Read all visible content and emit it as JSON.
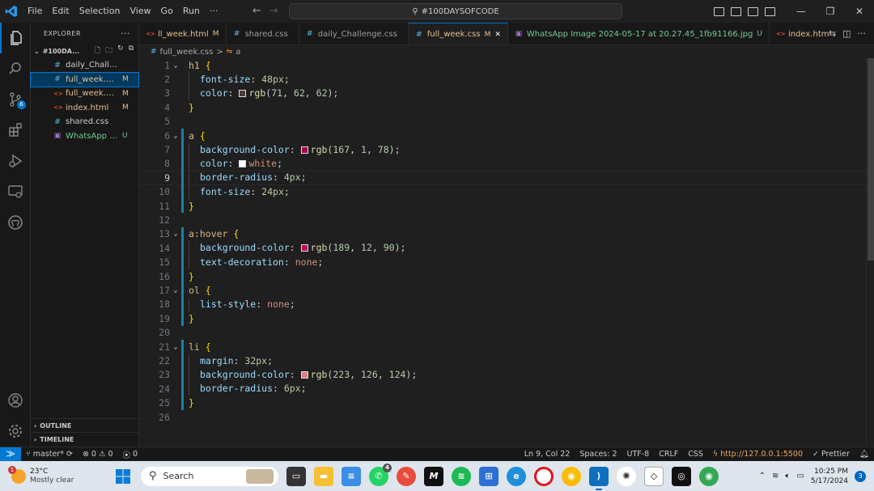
{
  "titlebar": {
    "menus": [
      "File",
      "Edit",
      "Selection",
      "View",
      "Go",
      "Run",
      "···"
    ],
    "search_text": "#100DAYSOFCODE",
    "window_controls": [
      "—",
      "❐",
      "✕"
    ]
  },
  "activity_bar": {
    "icons": [
      "files-icon",
      "search-icon",
      "source-control-icon",
      "extensions-icon",
      "run-debug-icon",
      "remote-explorer-icon",
      "github-icon"
    ],
    "source_control_badge": "6",
    "bottom_icons": [
      "account-icon",
      "settings-icon"
    ]
  },
  "sidebar": {
    "title": "EXPLORER",
    "menu_glyph": "···",
    "folder": "#100DA...",
    "files": [
      {
        "name": "daily_Challenge.css",
        "status": "",
        "type": "css",
        "color": "#cccccc"
      },
      {
        "name": "full_week.css",
        "status": "M",
        "type": "css",
        "color": "#e2c08d"
      },
      {
        "name": "full_week.ht...",
        "status": "M",
        "type": "html",
        "color": "#e2c08d"
      },
      {
        "name": "index.html",
        "status": "M",
        "type": "html",
        "color": "#e2c08d"
      },
      {
        "name": "shared.css",
        "status": "",
        "type": "css",
        "color": "#cccccc"
      },
      {
        "name": "WhatsApp I...",
        "status": "U",
        "type": "img",
        "color": "#73c991"
      }
    ],
    "outline_label": "OUTLINE",
    "timeline_label": "TIMELINE"
  },
  "tabs": [
    {
      "name": "ll_week.html",
      "status": "M",
      "type": "html",
      "active": false
    },
    {
      "name": "shared.css",
      "status": "",
      "type": "css",
      "active": false
    },
    {
      "name": "daily_Challenge.css",
      "status": "",
      "type": "css",
      "active": false
    },
    {
      "name": "full_week.css",
      "status": "M",
      "type": "css",
      "active": true
    },
    {
      "name": "WhatsApp Image 2024-05-17 at 20.27.45_1fb91166.jpg",
      "status": "U",
      "type": "img",
      "active": false
    },
    {
      "name": "index.html",
      "status": "M",
      "type": "html",
      "active": false
    }
  ],
  "breadcrumb": {
    "file": "full_week.css",
    "separator": ">",
    "symbol": "a"
  },
  "editor": {
    "current_line": 9,
    "lines": [
      {
        "n": 1,
        "fold": true,
        "indent": 0,
        "parts": [
          [
            "sel",
            "h1"
          ],
          [
            "txt",
            " "
          ],
          [
            "brace",
            "{"
          ]
        ]
      },
      {
        "n": 2,
        "indent": 1,
        "parts": [
          [
            "prop",
            "font-size"
          ],
          [
            "txt",
            ": "
          ],
          [
            "num",
            "48px"
          ],
          [
            "txt",
            ";"
          ]
        ]
      },
      {
        "n": 3,
        "indent": 1,
        "parts": [
          [
            "prop",
            "color"
          ],
          [
            "txt",
            ": "
          ],
          [
            "swatch",
            "#473e3e"
          ],
          [
            "fn",
            "rgb"
          ],
          [
            "txt",
            "("
          ],
          [
            "num",
            "71"
          ],
          [
            "txt",
            ", "
          ],
          [
            "num",
            "62"
          ],
          [
            "txt",
            ", "
          ],
          [
            "num",
            "62"
          ],
          [
            "txt",
            ");"
          ]
        ]
      },
      {
        "n": 4,
        "indent": 0,
        "parts": [
          [
            "brace",
            "}"
          ]
        ]
      },
      {
        "n": 5,
        "indent": 0,
        "parts": []
      },
      {
        "n": 6,
        "fold": true,
        "indent": 0,
        "mod": true,
        "parts": [
          [
            "sel",
            "a"
          ],
          [
            "txt",
            " "
          ],
          [
            "brace",
            "{"
          ]
        ]
      },
      {
        "n": 7,
        "indent": 1,
        "mod": true,
        "parts": [
          [
            "prop",
            "background-color"
          ],
          [
            "txt",
            ": "
          ],
          [
            "swatch",
            "#a7014e"
          ],
          [
            "fn",
            "rgb"
          ],
          [
            "txt",
            "("
          ],
          [
            "num",
            "167"
          ],
          [
            "txt",
            ", "
          ],
          [
            "num",
            "1"
          ],
          [
            "txt",
            ", "
          ],
          [
            "num",
            "78"
          ],
          [
            "txt",
            ");"
          ]
        ]
      },
      {
        "n": 8,
        "indent": 1,
        "mod": true,
        "parts": [
          [
            "prop",
            "color"
          ],
          [
            "txt",
            ": "
          ],
          [
            "swatch",
            "#ffffff"
          ],
          [
            "val",
            "white"
          ],
          [
            "txt",
            ";"
          ]
        ]
      },
      {
        "n": 9,
        "indent": 1,
        "mod": true,
        "parts": [
          [
            "prop",
            "border-radius"
          ],
          [
            "txt",
            ": "
          ],
          [
            "num",
            "4px"
          ],
          [
            "txt",
            ";"
          ]
        ]
      },
      {
        "n": 10,
        "indent": 1,
        "mod": true,
        "parts": [
          [
            "prop",
            "font-size"
          ],
          [
            "txt",
            ": "
          ],
          [
            "num",
            "24px"
          ],
          [
            "txt",
            ";"
          ]
        ]
      },
      {
        "n": 11,
        "indent": 0,
        "mod": true,
        "parts": [
          [
            "brace",
            "}"
          ]
        ]
      },
      {
        "n": 12,
        "indent": 0,
        "parts": []
      },
      {
        "n": 13,
        "fold": true,
        "indent": 0,
        "mod": true,
        "parts": [
          [
            "sel",
            "a:hover"
          ],
          [
            "txt",
            " "
          ],
          [
            "brace",
            "{"
          ]
        ]
      },
      {
        "n": 14,
        "indent": 1,
        "mod": true,
        "parts": [
          [
            "prop",
            "background-color"
          ],
          [
            "txt",
            ": "
          ],
          [
            "swatch",
            "#bd0c5a"
          ],
          [
            "fn",
            "rgb"
          ],
          [
            "txt",
            "("
          ],
          [
            "num",
            "189"
          ],
          [
            "txt",
            ", "
          ],
          [
            "num",
            "12"
          ],
          [
            "txt",
            ", "
          ],
          [
            "num",
            "90"
          ],
          [
            "txt",
            ");"
          ]
        ]
      },
      {
        "n": 15,
        "indent": 1,
        "mod": true,
        "parts": [
          [
            "prop",
            "text-decoration"
          ],
          [
            "txt",
            ": "
          ],
          [
            "val",
            "none"
          ],
          [
            "txt",
            ";"
          ]
        ]
      },
      {
        "n": 16,
        "indent": 0,
        "mod": true,
        "parts": [
          [
            "brace",
            "}"
          ]
        ]
      },
      {
        "n": 17,
        "fold": true,
        "indent": 0,
        "mod": true,
        "parts": [
          [
            "sel",
            "ol"
          ],
          [
            "txt",
            " "
          ],
          [
            "brace",
            "{"
          ]
        ]
      },
      {
        "n": 18,
        "indent": 1,
        "mod": true,
        "parts": [
          [
            "prop",
            "list-style"
          ],
          [
            "txt",
            ": "
          ],
          [
            "val",
            "none"
          ],
          [
            "txt",
            ";"
          ]
        ]
      },
      {
        "n": 19,
        "indent": 0,
        "mod": true,
        "parts": [
          [
            "brace",
            "}"
          ]
        ]
      },
      {
        "n": 20,
        "indent": 0,
        "parts": []
      },
      {
        "n": 21,
        "fold": true,
        "indent": 0,
        "mod": true,
        "parts": [
          [
            "sel",
            "li"
          ],
          [
            "txt",
            " "
          ],
          [
            "brace",
            "{"
          ]
        ]
      },
      {
        "n": 22,
        "indent": 1,
        "mod": true,
        "parts": [
          [
            "prop",
            "margin"
          ],
          [
            "txt",
            ": "
          ],
          [
            "num",
            "32px"
          ],
          [
            "txt",
            ";"
          ]
        ]
      },
      {
        "n": 23,
        "indent": 1,
        "mod": true,
        "parts": [
          [
            "prop",
            "background-color"
          ],
          [
            "txt",
            ": "
          ],
          [
            "swatch",
            "#df7e7c"
          ],
          [
            "fn",
            "rgb"
          ],
          [
            "txt",
            "("
          ],
          [
            "num",
            "223"
          ],
          [
            "txt",
            ", "
          ],
          [
            "num",
            "126"
          ],
          [
            "txt",
            ", "
          ],
          [
            "num",
            "124"
          ],
          [
            "txt",
            ");"
          ]
        ]
      },
      {
        "n": 24,
        "indent": 1,
        "mod": true,
        "parts": [
          [
            "prop",
            "border-radius"
          ],
          [
            "txt",
            ": "
          ],
          [
            "num",
            "6px"
          ],
          [
            "txt",
            ";"
          ]
        ]
      },
      {
        "n": 25,
        "indent": 0,
        "mod": true,
        "parts": [
          [
            "brace",
            "}"
          ]
        ]
      },
      {
        "n": 26,
        "indent": 0,
        "parts": []
      }
    ]
  },
  "statusbar": {
    "branch": "master*",
    "errors": "0",
    "warnings": "0",
    "ports": "0",
    "cursor": "Ln 9, Col 22",
    "spaces": "Spaces: 2",
    "encoding": "UTF-8",
    "eol": "CRLF",
    "language": "CSS",
    "live_server": "http://127.0.0.1:5500",
    "prettier": "Prettier"
  },
  "taskbar": {
    "weather_temp": "23°C",
    "weather_desc": "Mostly clear",
    "weather_badge": "1",
    "search_label": "Search",
    "time": "10:25 PM",
    "date": "5/17/2024",
    "notifications": "3",
    "whatsapp_badge": "4"
  },
  "colors": {
    "accent": "#0078d4",
    "modified": "#e2c08d",
    "untracked": "#73c991"
  }
}
